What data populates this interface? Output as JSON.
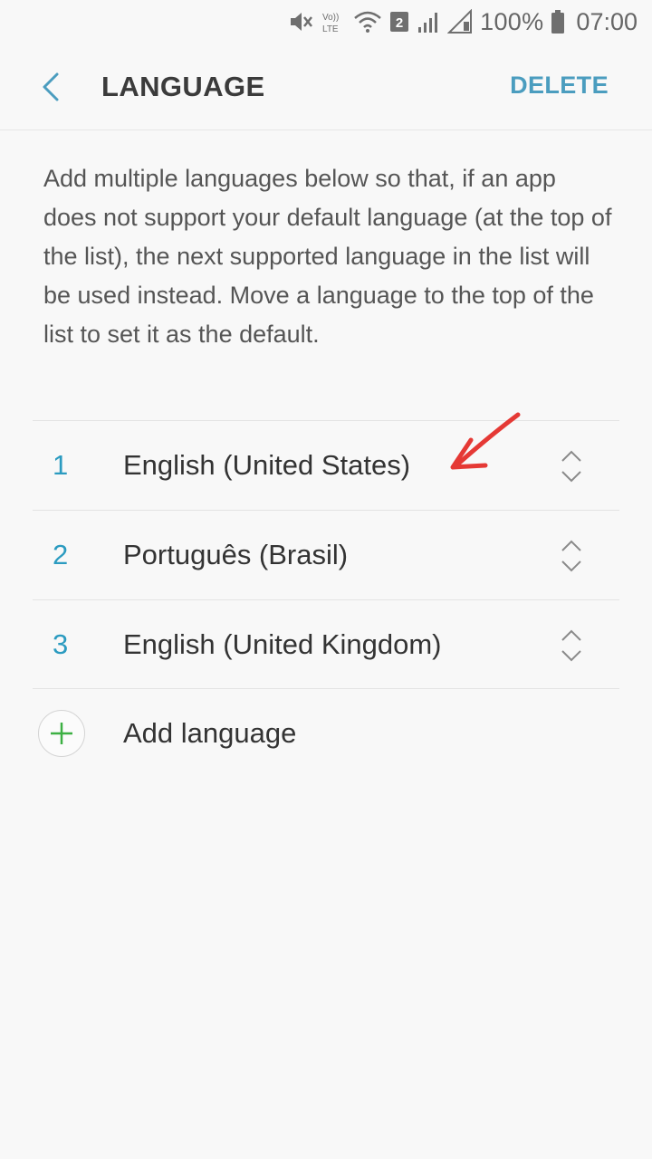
{
  "status_bar": {
    "volte_label": "Vo)) LTE",
    "sim_badge": "2",
    "battery_text": "100%",
    "time": "07:00",
    "icons": [
      "mute-icon",
      "volte-icon",
      "wifi-icon",
      "sim-2-icon",
      "signal-icon",
      "signal-empty-icon",
      "battery-icon"
    ]
  },
  "header": {
    "back_icon": "chevron-left-icon",
    "title": "LANGUAGE",
    "delete_label": "DELETE"
  },
  "description": "Add multiple languages below so that, if an app does not support your default language (at the top of the list), the next supported language in the list will be used instead. Move a language to the top of the list to set it as the default.",
  "languages": [
    {
      "number": "1",
      "name": "English (United States)"
    },
    {
      "number": "2",
      "name": "Português (Brasil)"
    },
    {
      "number": "3",
      "name": "English (United Kingdom)"
    }
  ],
  "add_language": {
    "icon": "plus-icon",
    "label": "Add language"
  },
  "colors": {
    "accent": "#2b9bc0",
    "header_action": "#4b9dbf",
    "plus": "#3cb043",
    "annotation": "#e53935",
    "background": "#f8f8f8"
  }
}
